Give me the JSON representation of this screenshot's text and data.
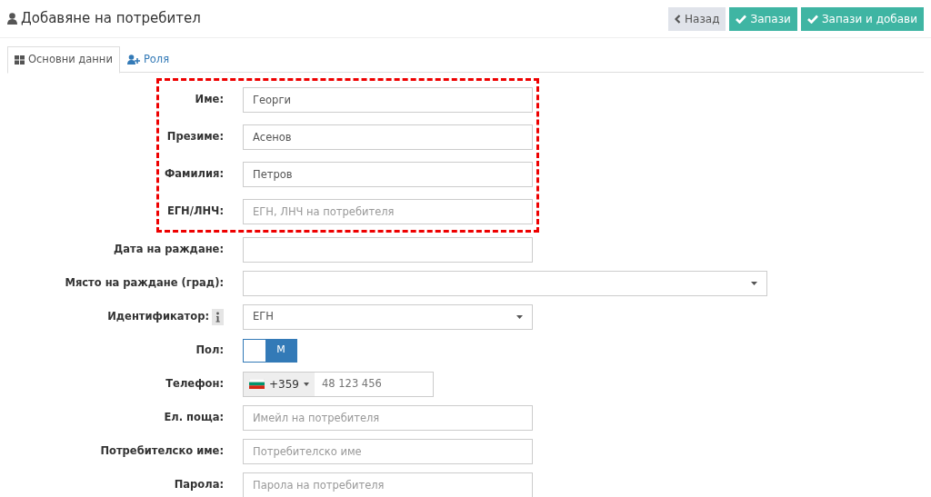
{
  "header": {
    "title": "Добавяне на потребител",
    "buttons": [
      {
        "kind": "back",
        "label": "Назад"
      },
      {
        "kind": "save",
        "label": "Запази"
      },
      {
        "kind": "save",
        "label": "Запази и добави"
      }
    ]
  },
  "tabs": [
    {
      "kind": "grid",
      "label": "Основни данни",
      "selected": true
    },
    {
      "kind": "user-plus",
      "label": "Роля",
      "selected": false
    }
  ],
  "highlighted_fields": [
    {
      "kind": "text",
      "label": "Име:",
      "value": "Георги"
    },
    {
      "kind": "text",
      "label": "Презиме:",
      "value": "Асенов"
    },
    {
      "kind": "text",
      "label": "Фамилия:",
      "value": "Петров"
    },
    {
      "kind": "text",
      "label": "ЕГН/ЛНЧ:",
      "placeholder": "ЕГН, ЛНЧ на потребителя"
    }
  ],
  "fields": [
    {
      "kind": "text",
      "label": "Дата на раждане:"
    },
    {
      "kind": "select",
      "label": "Място на раждане (град):",
      "wide": true
    },
    {
      "kind": "select",
      "label": "Идентификатор:",
      "value": "ЕГН",
      "info": true
    },
    {
      "kind": "toggle",
      "label": "Пол:",
      "value": "М",
      "on": false
    },
    {
      "kind": "phone",
      "label": "Телефон:",
      "code": "+359",
      "placeholder": "48 123 456"
    },
    {
      "kind": "text",
      "label": "Ел. поща:",
      "placeholder": "Имейл на потребителя"
    },
    {
      "kind": "text",
      "label": "Потребителско име:",
      "placeholder": "Потребителско име"
    },
    {
      "kind": "text",
      "label": "Парола:",
      "placeholder": "Парола на потребителя"
    }
  ]
}
